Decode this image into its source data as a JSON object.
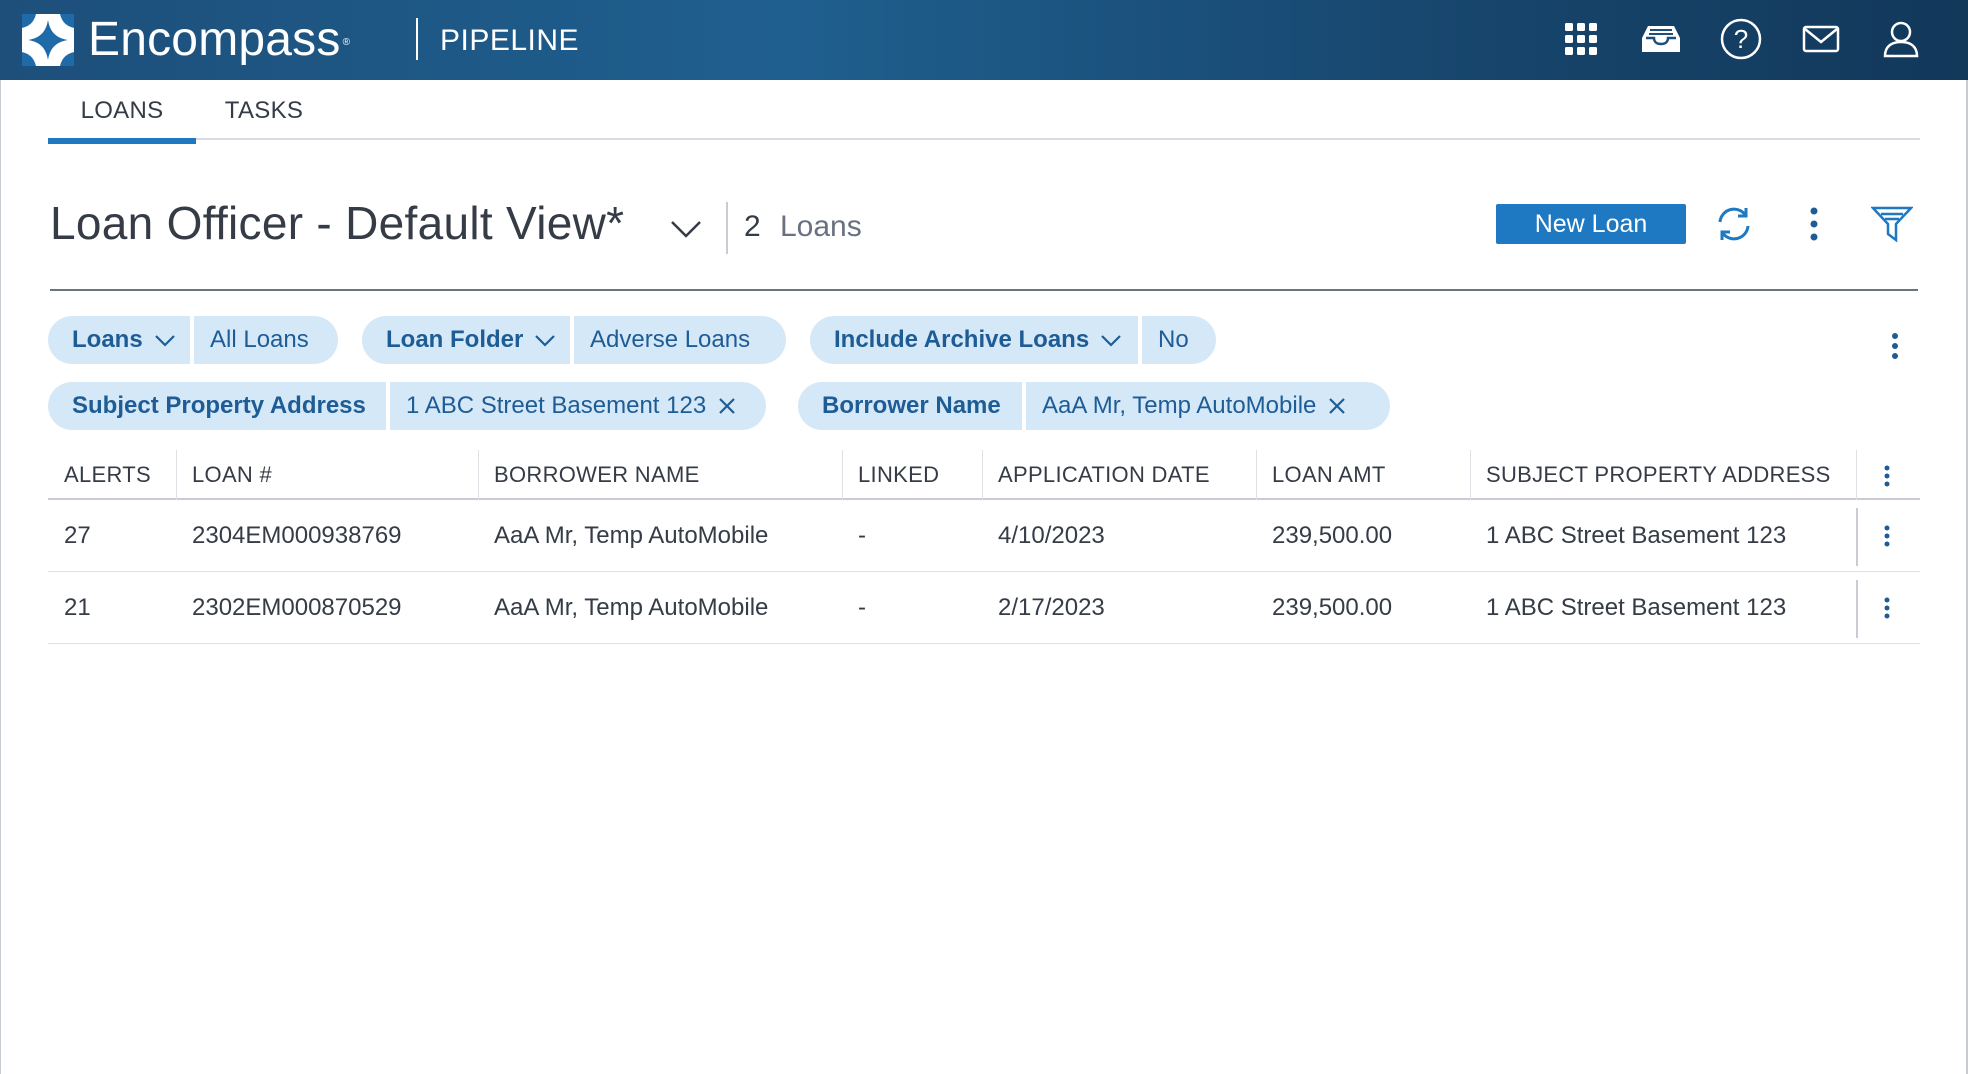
{
  "header": {
    "brand": "Encompass",
    "brand_mark": "®",
    "app": "PIPELINE",
    "icons": [
      "apps-grid-icon",
      "inbox-tray-icon",
      "help-icon",
      "mail-icon",
      "user-icon"
    ]
  },
  "tabs": [
    {
      "label": "LOANS",
      "active": true
    },
    {
      "label": "TASKS",
      "active": false
    }
  ],
  "view": {
    "title": "Loan Officer - Default View*",
    "count": "2",
    "count_label": "Loans",
    "new_loan_label": "New Loan"
  },
  "filters": [
    {
      "key": "Loans",
      "value": "All Loans",
      "dropdown": true
    },
    {
      "key": "Loan Folder",
      "value": "Adverse Loans",
      "dropdown": true
    },
    {
      "key": "Include Archive Loans",
      "value": "No",
      "dropdown": true
    },
    {
      "key": "Subject Property Address",
      "value": "1 ABC Street Basement 123",
      "removable": true
    },
    {
      "key": "Borrower Name",
      "value": "AaA Mr, Temp AutoMobile",
      "removable": true
    }
  ],
  "table": {
    "columns": [
      "ALERTS",
      "LOAN #",
      "BORROWER NAME",
      "LINKED",
      "APPLICATION DATE",
      "LOAN AMT",
      "SUBJECT PROPERTY ADDRESS"
    ],
    "rows": [
      [
        "27",
        "2304EM000938769",
        "AaA Mr, Temp AutoMobile",
        "-",
        "4/10/2023",
        "239,500.00",
        "1 ABC Street Basement 123"
      ],
      [
        "21",
        "2302EM000870529",
        "AaA Mr, Temp AutoMobile",
        "-",
        "2/17/2023",
        "239,500.00",
        "1 ABC Street Basement 123"
      ]
    ]
  },
  "colors": {
    "header_bg": "#1d4f7a",
    "accent": "#1e79c2",
    "chip_bg": "#d5e8f8",
    "chip_text": "#1e5c95"
  }
}
